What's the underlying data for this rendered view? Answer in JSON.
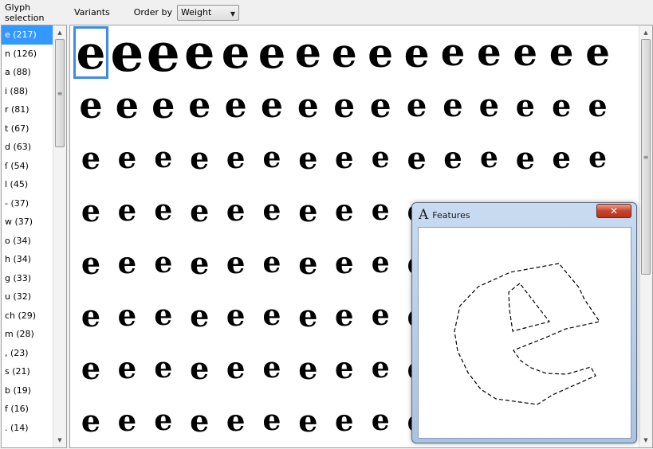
{
  "left_panel": {
    "header": "Glyph selection",
    "glyphs": [
      "e (217)",
      "n (126)",
      "a (88)",
      "i (88)",
      "r (81)",
      "t (67)",
      "d (63)",
      "ſ (54)",
      "l (45)",
      "- (37)",
      "w (37)",
      "o (34)",
      "h (34)",
      "g (33)",
      "u (32)",
      "ch (29)",
      "m (28)",
      ", (23)",
      "s (21)",
      "b (19)",
      "f (16)",
      ". (14)"
    ],
    "selected_index": 0
  },
  "topbar": {
    "variants_label": "Variants",
    "order_label": "Order by",
    "order_value": "Weight"
  },
  "variants": {
    "glyph": "e",
    "columns": 15,
    "rows": 8,
    "selected_index": 0
  },
  "features_window": {
    "icon": "A",
    "title": "Features",
    "close_label": "✕"
  },
  "colors": {
    "selection": "#3399ff",
    "selection_outline": "#3c8ce6",
    "close_button": "#c7432b"
  }
}
